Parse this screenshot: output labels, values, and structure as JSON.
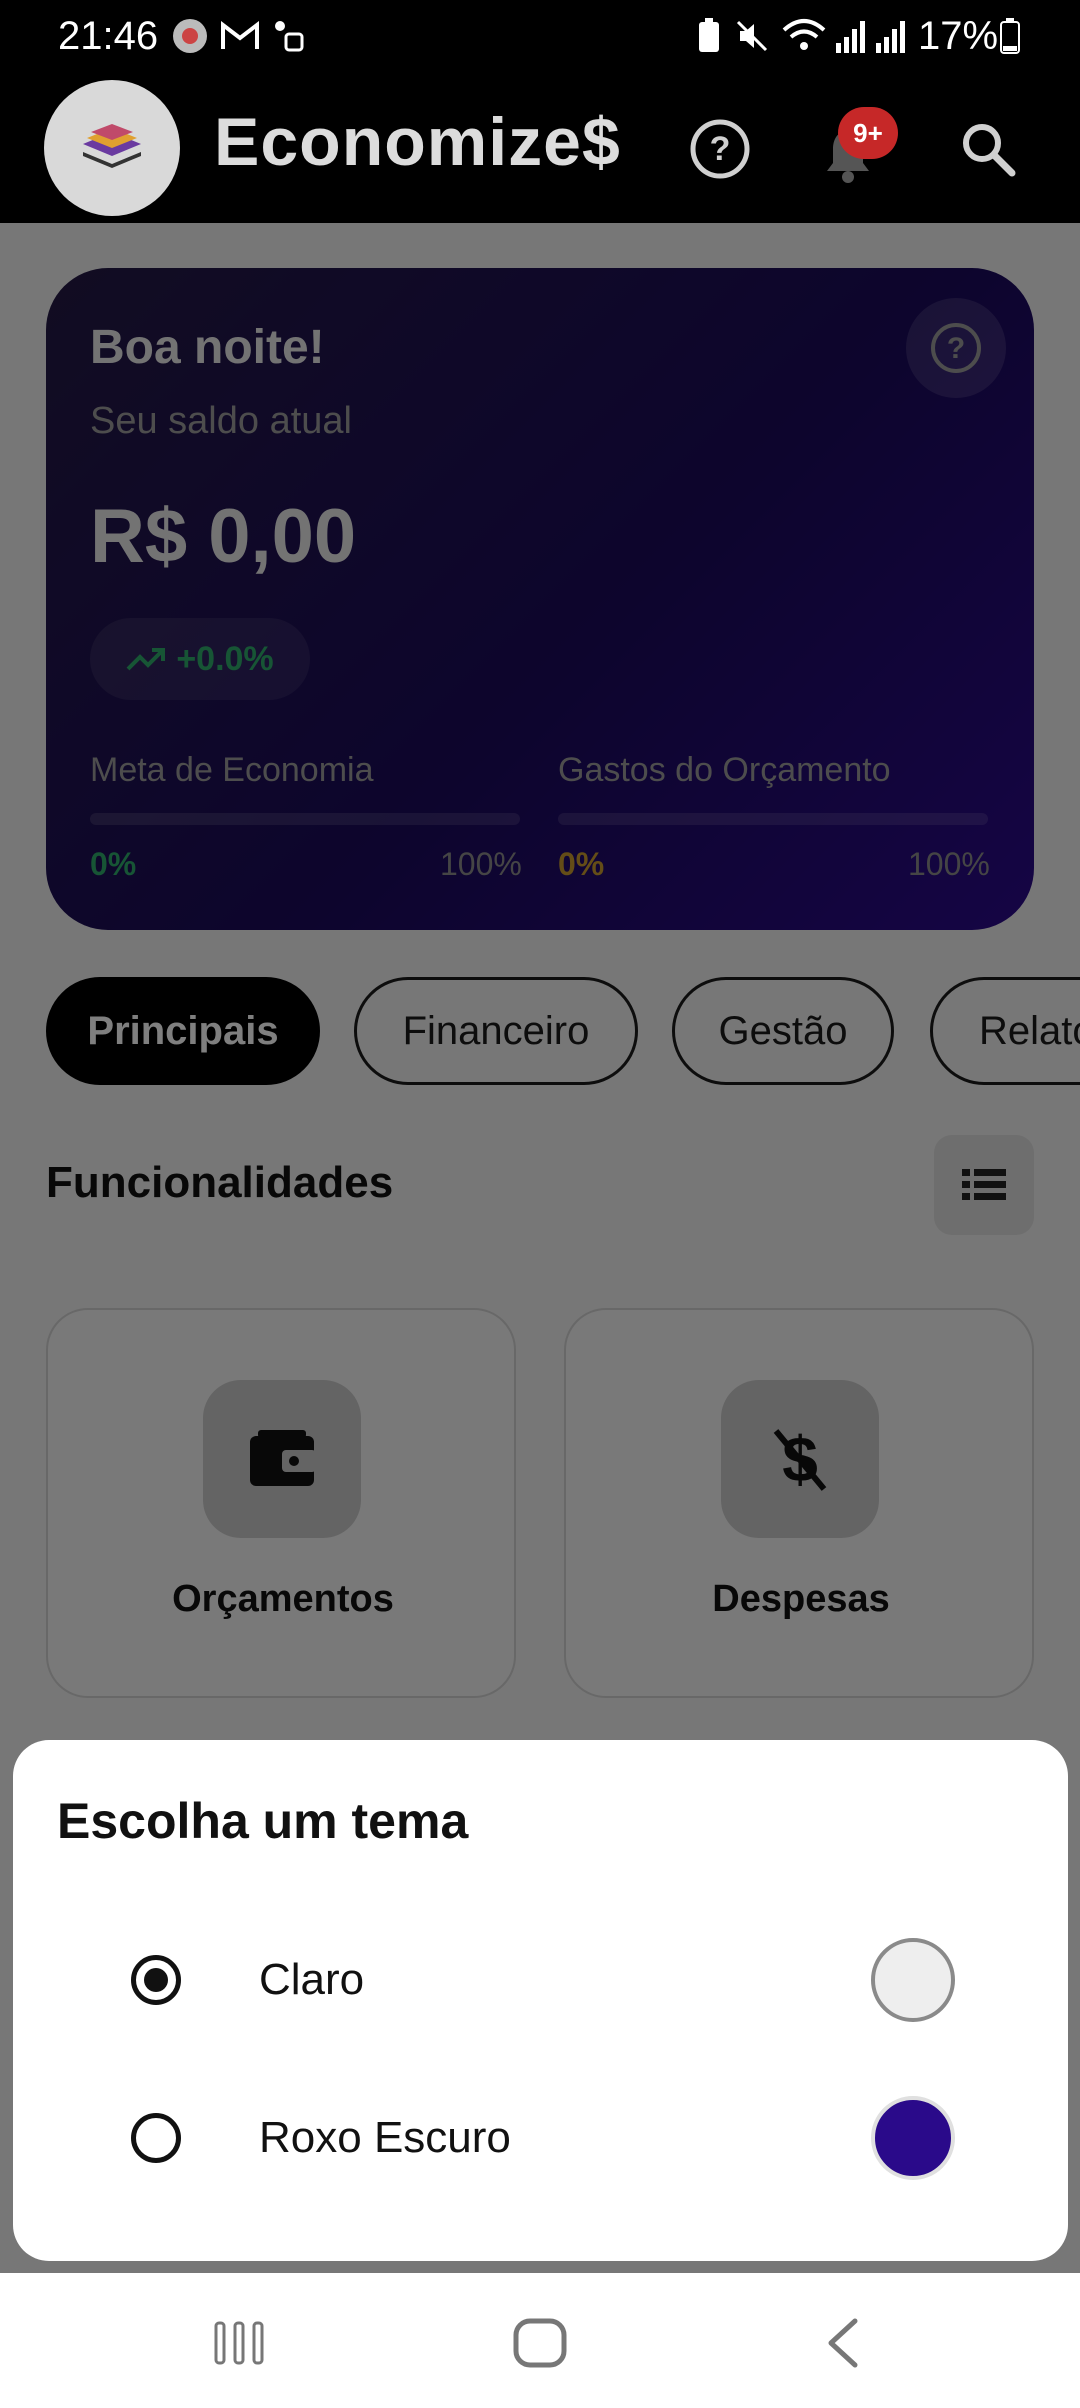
{
  "status_bar": {
    "time": "21:46",
    "battery_pct": "17%",
    "left_icons": [
      "app-notification-icon",
      "gmail-icon",
      "accessibility-icon"
    ],
    "right_icons": [
      "battery-saver-icon",
      "mute-icon",
      "wifi-icon",
      "signal-icon",
      "signal-icon-2",
      "battery-icon"
    ]
  },
  "app_bar": {
    "title": "Economize$",
    "badge": "9+",
    "icons": [
      "help-icon",
      "bell-icon",
      "search-icon"
    ]
  },
  "balance_card": {
    "greeting": "Boa noite!",
    "subtitle": "Seu saldo atual",
    "balance": "R$ 0,00",
    "trend": "+0.0%",
    "metrics": [
      {
        "label": "Meta de Economia",
        "pct": "0%",
        "max": "100%",
        "color": "#2faa6a",
        "progress": 0
      },
      {
        "label": "Gastos do Orçamento",
        "pct": "0%",
        "max": "100%",
        "color": "#c99a2e",
        "progress": 0
      }
    ]
  },
  "tabs": [
    {
      "label": "Principais",
      "active": true
    },
    {
      "label": "Financeiro",
      "active": false
    },
    {
      "label": "Gestão",
      "active": false
    },
    {
      "label": "Relatórios",
      "active": false
    }
  ],
  "features": {
    "title": "Funcionalidades",
    "items": [
      {
        "label": "Orçamentos",
        "icon": "wallet-icon"
      },
      {
        "label": "Despesas",
        "icon": "money-off-icon"
      }
    ]
  },
  "theme_dialog": {
    "title": "Escolha um tema",
    "options": [
      {
        "label": "Claro",
        "selected": true,
        "swatch": "#eeeeee"
      },
      {
        "label": "Roxo Escuro",
        "selected": false,
        "swatch": "#2a0a8a"
      }
    ]
  },
  "colors": {
    "accent_purple": "#2a0a8a",
    "badge_red": "#c62828",
    "trend_green": "#2faa6a",
    "budget_gold": "#c99a2e"
  }
}
